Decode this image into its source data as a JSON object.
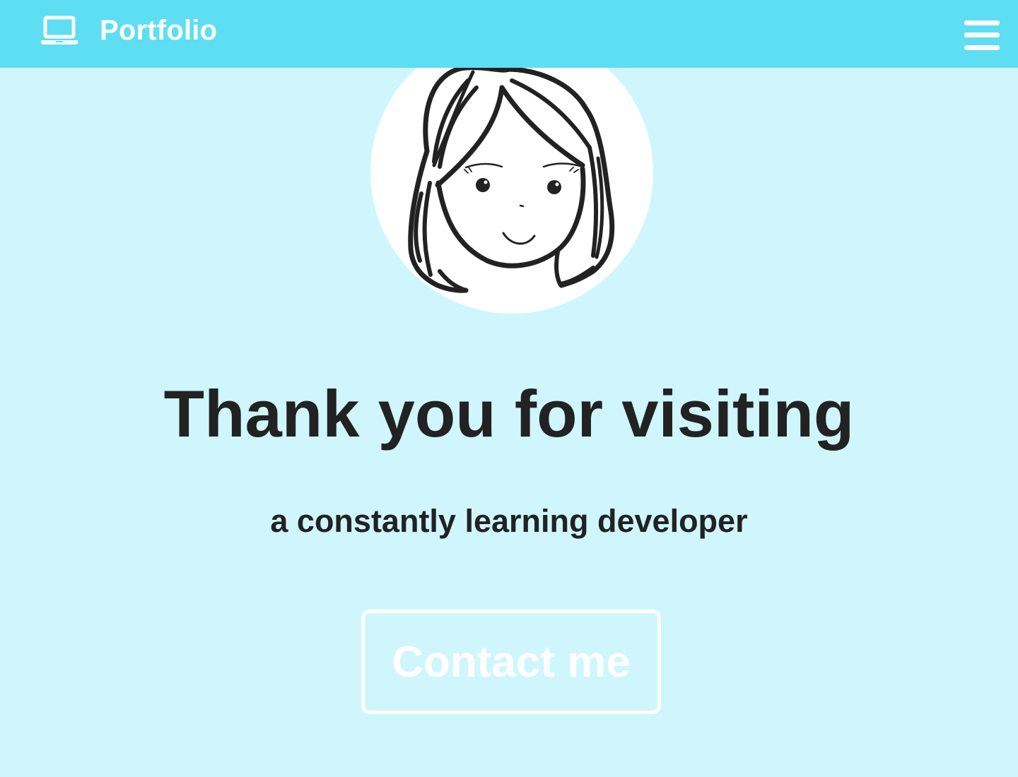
{
  "navbar": {
    "brand_icon": "laptop-icon",
    "brand_label": "Portfolio",
    "menu_icon": "hamburger-menu-icon",
    "background_color": "#5ddef2"
  },
  "hero": {
    "avatar_icon": "hand-drawn-girl-portrait",
    "title": "Thank you for visiting",
    "subtitle": "a constantly learning developer",
    "contact_button_label": "Contact me",
    "background_color": "#cff6fd"
  }
}
